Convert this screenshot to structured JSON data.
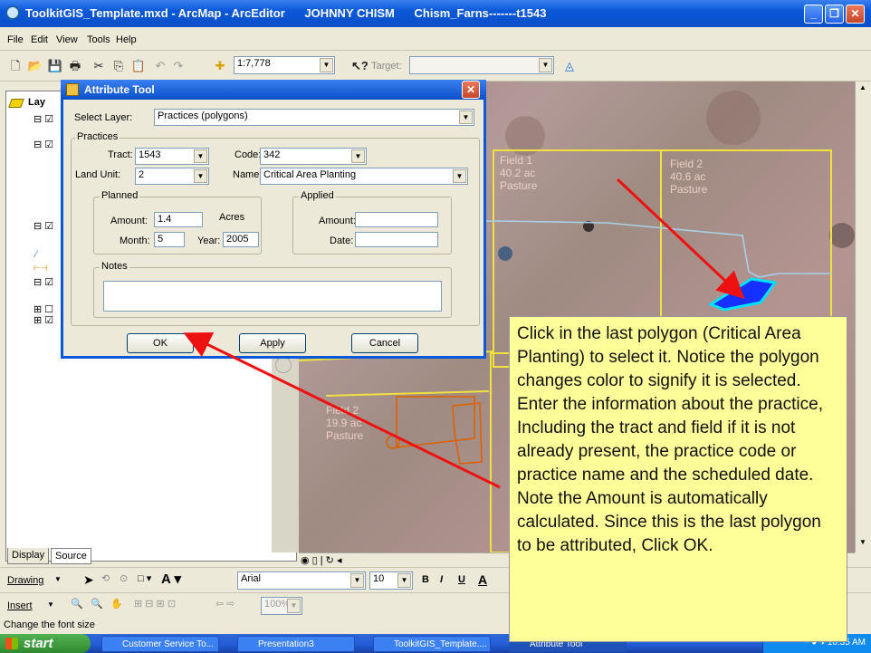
{
  "window": {
    "title": "ToolkitGIS_Template.mxd - ArcMap - ArcEditor      JOHNNY CHISM      Chism_Farns-------t1543"
  },
  "menu": [
    "File",
    "Edit",
    "View",
    "Tools",
    "Help"
  ],
  "toolbar": {
    "scale": "1:7,778",
    "target_label": "Target:",
    "target_value": ""
  },
  "toc": {
    "header": "Lay",
    "tabs": [
      "Display",
      "Source"
    ]
  },
  "dialog": {
    "title": "Attribute Tool",
    "select_layer_label": "Select Layer:",
    "select_layer_value": "Practices (polygons)",
    "practices_label": "Practices",
    "tract_label": "Tract:",
    "tract_value": "1543",
    "code_label": "Code:",
    "code_value": "342",
    "land_unit_label": "Land Unit:",
    "land_unit_value": "2",
    "name_label": "Name:",
    "name_value": "Critical Area Planting",
    "planned_label": "Planned",
    "amount_label": "Amount:",
    "amount_value": "1.4",
    "acres_label": "Acres",
    "month_label": "Month:",
    "month_value": "5",
    "year_label": "Year:",
    "year_value": "2005",
    "applied_label": "Applied",
    "applied_amount_label": "Amount:",
    "applied_amount_value": "",
    "date_label": "Date:",
    "date_value": "",
    "notes_label": "Notes",
    "notes_value": "",
    "ok_label": "OK",
    "apply_label": "Apply",
    "cancel_label": "Cancel"
  },
  "map_labels": {
    "field1": [
      "Field 1",
      "40.2 ac",
      "Pasture"
    ],
    "field2": [
      "Field 2",
      "40.6 ac",
      "Pasture"
    ],
    "field3": [
      "Field 2",
      "19.9 ac",
      "Pasture"
    ]
  },
  "drawbar": {
    "drawing_label": "Drawing",
    "font_value": "Arial",
    "size_value": "10",
    "bold": "B",
    "italic": "I",
    "underline": "U",
    "fontcolor": "A"
  },
  "insertbar": {
    "insert_label": "Insert",
    "zoom_value": "100%"
  },
  "status_text": "Change the font size",
  "taskbar": {
    "start_label": "start",
    "tasks": [
      "Customer Service To...",
      "Presentation3",
      "ToolkitGIS_Template....",
      "Attribute Tool"
    ],
    "clock": "10:35 AM"
  },
  "callout_text": "Click in the last polygon (Critical Area Planting) to select it. Notice the polygon changes color to signify it is selected. Enter the information about the practice, Including the tract and field if it is not already present, the practice code or practice name and the scheduled date. Note the Amount is automatically calculated. Since this is the last polygon to be attributed, Click OK.",
  "colors": {
    "xp_blue": "#0a58d8",
    "field_outline": "#f0e040",
    "selected_polygon": "#1e3cff",
    "arrow": "#ee1111",
    "callout_bg": "#ffff99"
  }
}
